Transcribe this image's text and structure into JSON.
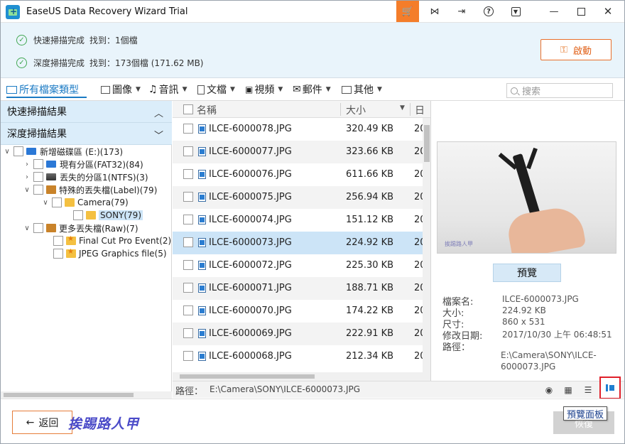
{
  "window": {
    "title": "EaseUS Data Recovery Wizard Trial",
    "icons": [
      "app-icon",
      "cart-icon",
      "share-icon",
      "exit-icon",
      "help-icon",
      "menu-icon",
      "minimize-icon",
      "maximize-icon",
      "close-icon"
    ]
  },
  "status": {
    "quick_label": "快速掃描完成",
    "quick_count": "找到：1個檔",
    "deep_label": "深度掃描完成",
    "deep_count": "找到：173個檔 (171.62 MB)",
    "launch_label": "啟動"
  },
  "filters": {
    "all": "所有檔案類型",
    "images": "圖像",
    "audio": "音訊",
    "docs": "文檔",
    "video": "視頻",
    "mail": "郵件",
    "other": "其他",
    "search_placeholder": "搜索"
  },
  "left_panel": {
    "quick_head": "快速掃描結果",
    "deep_head": "深度掃描結果",
    "tree": [
      {
        "label": "新增磁碟區 (E:)(173)"
      },
      {
        "label": "現有分區(FAT32)(84)"
      },
      {
        "label": "丟失的分區1(NTFS)(3)"
      },
      {
        "label": "特殊的丟失檔(Label)(79)"
      },
      {
        "label": "Camera(79)"
      },
      {
        "label": "SONY(79)"
      },
      {
        "label": "更多丟失檔(Raw)(7)"
      },
      {
        "label": "Final Cut Pro Event(2)"
      },
      {
        "label": "JPEG Graphics file(5)"
      }
    ]
  },
  "file_list": {
    "col_name": "名稱",
    "col_size": "大小",
    "col_date": "日",
    "rows": [
      {
        "name": "ILCE-6000078.JPG",
        "size": "320.49 KB",
        "date": "20"
      },
      {
        "name": "ILCE-6000077.JPG",
        "size": "323.66 KB",
        "date": "20"
      },
      {
        "name": "ILCE-6000076.JPG",
        "size": "611.66 KB",
        "date": "20"
      },
      {
        "name": "ILCE-6000075.JPG",
        "size": "256.94 KB",
        "date": "20"
      },
      {
        "name": "ILCE-6000074.JPG",
        "size": "151.12 KB",
        "date": "20"
      },
      {
        "name": "ILCE-6000073.JPG",
        "size": "224.92 KB",
        "date": "20"
      },
      {
        "name": "ILCE-6000072.JPG",
        "size": "225.30 KB",
        "date": "20"
      },
      {
        "name": "ILCE-6000071.JPG",
        "size": "188.71 KB",
        "date": "20"
      },
      {
        "name": "ILCE-6000070.JPG",
        "size": "174.22 KB",
        "date": "20"
      },
      {
        "name": "ILCE-6000069.JPG",
        "size": "222.91 KB",
        "date": "20"
      },
      {
        "name": "ILCE-6000068.JPG",
        "size": "212.34 KB",
        "date": "20"
      }
    ]
  },
  "preview": {
    "watermark": "挨踢路人甲",
    "button": "預覽",
    "name_label": "檔案名:",
    "name_value": "ILCE-6000073.JPG",
    "size_label": "大小:",
    "size_value": "224.92 KB",
    "dim_label": "尺寸:",
    "dim_value": "860 x 531",
    "date_label": "修改日期:",
    "date_value": "2017/10/30 上午 06:48:51",
    "path_label": "路徑：",
    "path_value": "E:\\Camera\\SONY\\ILCE-6000073.JPG"
  },
  "pathbar": {
    "label": "路徑：",
    "value": "E:\\Camera\\SONY\\ILCE-6000073.JPG"
  },
  "bottom": {
    "back": "返回",
    "watermark": "挨踢路人甲",
    "recover": "恢復",
    "tooltip": "預覽面板"
  },
  "colors": {
    "accent": "#1a7ac4",
    "cart": "#f47d2a",
    "status_bg": "#e9f4fb",
    "selection": "#cce4f7",
    "highlight_box": "#e0202a"
  }
}
